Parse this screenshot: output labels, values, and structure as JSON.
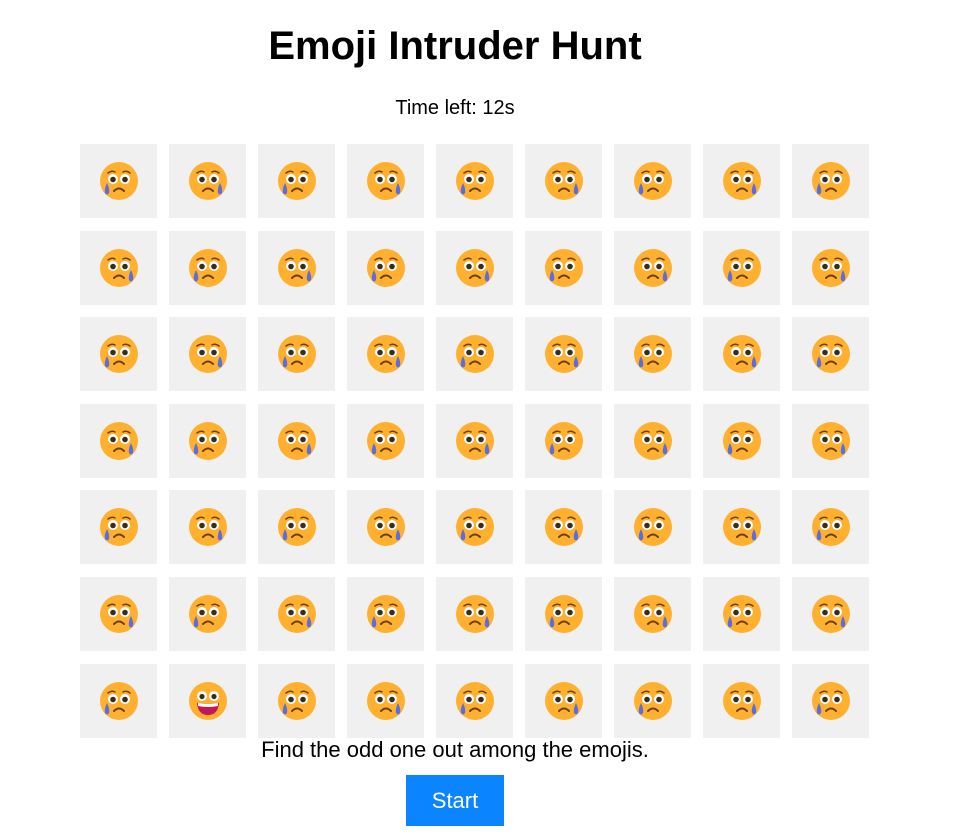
{
  "game": {
    "title": "Emoji Intruder Hunt",
    "timer_text": "Time left: 12s",
    "time_left_seconds": 12,
    "instructions": "Find the odd one out among the emojis.",
    "start_label": "Start"
  },
  "grid": {
    "rows": 7,
    "cols": 9,
    "common_emoji": "pleading-face-with-tear-icon",
    "odd_emoji": "grinning-face-icon",
    "odd_position": {
      "row": 7,
      "col": 2
    }
  },
  "colors": {
    "cell_bg": "#f0f0f0",
    "button_bg": "#0b84ff",
    "button_text": "#ffffff",
    "emoji_face": "#ffb02e",
    "emoji_tear": "#5b6ee1",
    "emoji_mouth_odd": "#c2185b"
  }
}
